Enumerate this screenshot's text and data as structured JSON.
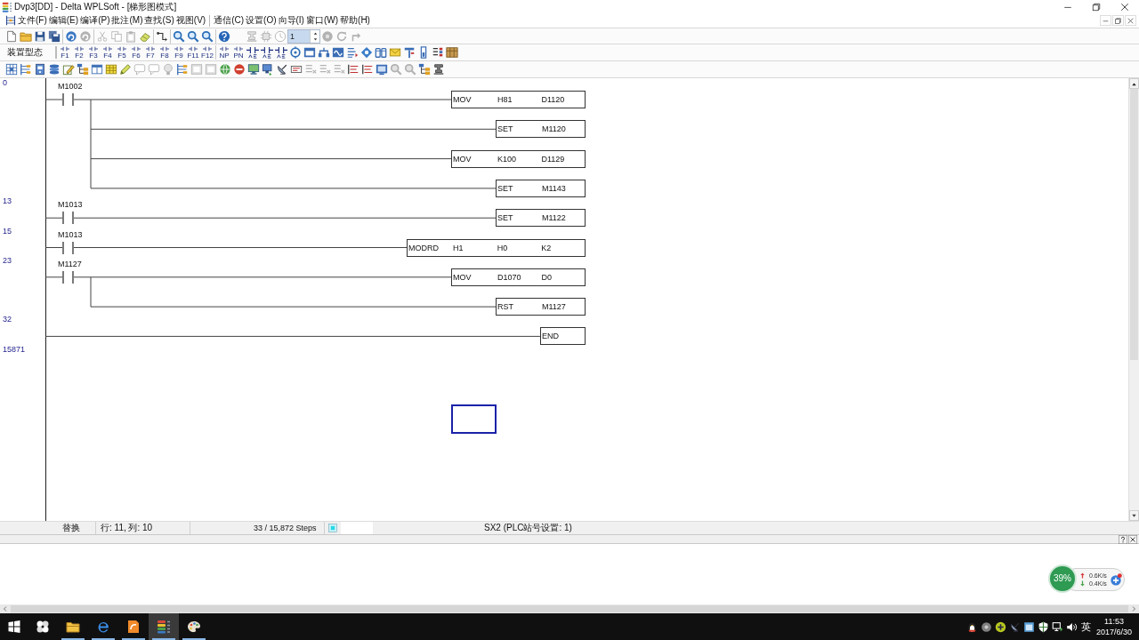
{
  "window": {
    "title": "Dvp3[DD] - Delta WPLSoft - [梯形图模式]"
  },
  "menu_bar": {
    "groups": [
      [
        "文件(F)",
        "编辑(E)",
        "编译(P)",
        "批注(M)",
        "查找(S)",
        "视图(V)"
      ],
      [
        "通信(C)",
        "设置(O)",
        "向导(I)",
        "窗口(W)",
        "帮助(H)"
      ]
    ]
  },
  "toolbar_main": {
    "groups": [
      [
        {
          "kind": "page",
          "disabled": false
        },
        {
          "kind": "folder",
          "disabled": false
        },
        {
          "kind": "floppy-disk",
          "disabled": false
        },
        {
          "kind": "floppy-stack",
          "disabled": false
        }
      ],
      [
        {
          "kind": "round-arrow",
          "disabled": false
        },
        {
          "kind": "round-arrow",
          "disabled": true
        }
      ],
      [
        {
          "kind": "scissors",
          "disabled": true
        },
        {
          "kind": "copy-pages",
          "disabled": true
        },
        {
          "kind": "clipboard",
          "disabled": true
        },
        {
          "kind": "eraser",
          "disabled": false
        }
      ],
      [
        {
          "kind": "wire-hook",
          "disabled": false
        }
      ],
      [
        {
          "kind": "magnifier",
          "disabled": false
        },
        {
          "kind": "magnifier",
          "disabled": false
        },
        {
          "kind": "magnifier",
          "disabled": false
        }
      ],
      [
        {
          "kind": "help",
          "disabled": false
        }
      ],
      [
        {
          "kind": "stamp",
          "disabled": true
        },
        {
          "kind": "chip",
          "disabled": true
        },
        {
          "kind": "clock",
          "disabled": true
        },
        {
          "kind": "spin-field",
          "value": "1"
        },
        {
          "kind": "disc",
          "disabled": true
        },
        {
          "kind": "refresh",
          "disabled": true
        },
        {
          "kind": "bent-arrow",
          "disabled": true
        }
      ]
    ]
  },
  "toolbar_ladder": {
    "device_label": "装置型态",
    "groups": [
      [
        {
          "kind": "contact-key",
          "label": "F1"
        },
        {
          "kind": "contact-key",
          "label": "F2"
        },
        {
          "kind": "contact-key",
          "label": "F3"
        },
        {
          "kind": "contact-key",
          "label": "F4"
        },
        {
          "kind": "contact-key",
          "label": "F5"
        },
        {
          "kind": "contact-key",
          "label": "F6"
        },
        {
          "kind": "contact-key",
          "label": "F7"
        },
        {
          "kind": "contact-key",
          "label": "F8"
        },
        {
          "kind": "contact-key",
          "label": "F9"
        },
        {
          "kind": "contact-key",
          "label": "F11"
        },
        {
          "kind": "contact-key",
          "label": "F12"
        }
      ],
      [
        {
          "kind": "contact-key",
          "label": "NP"
        },
        {
          "kind": "contact-key",
          "label": "PN"
        },
        {
          "kind": "contact-variant"
        },
        {
          "kind": "contact-variant"
        },
        {
          "kind": "contact-variant"
        },
        {
          "kind": "target"
        },
        {
          "kind": "window-panel"
        },
        {
          "kind": "bridge"
        },
        {
          "kind": "wave"
        },
        {
          "kind": "list-arrows"
        },
        {
          "kind": "diamond"
        },
        {
          "kind": "columns"
        },
        {
          "kind": "envelope"
        },
        {
          "kind": "pin"
        },
        {
          "kind": "gauge"
        },
        {
          "kind": "list-bars"
        },
        {
          "kind": "grid-block"
        }
      ]
    ]
  },
  "toolbar_tools": [
    {
      "kind": "grid-chart",
      "disabled": false
    },
    {
      "kind": "ladder-list",
      "disabled": false
    },
    {
      "kind": "device",
      "disabled": false
    },
    {
      "kind": "stack",
      "disabled": false
    },
    {
      "kind": "pencil-square",
      "disabled": false
    },
    {
      "kind": "tree",
      "disabled": false
    },
    {
      "kind": "window",
      "disabled": false
    },
    {
      "kind": "notes",
      "disabled": false
    },
    {
      "kind": "pencil",
      "disabled": false
    },
    {
      "kind": "speech",
      "disabled": true
    },
    {
      "kind": "speech",
      "disabled": true
    },
    {
      "kind": "bulb",
      "disabled": true
    },
    {
      "kind": "ladder-list",
      "disabled": false
    },
    {
      "kind": "panel",
      "disabled": true
    },
    {
      "kind": "panel",
      "disabled": true
    },
    {
      "kind": "globe",
      "disabled": false
    },
    {
      "kind": "stop",
      "disabled": false
    },
    {
      "kind": "monitor",
      "disabled": false
    },
    {
      "kind": "monitor-arrow",
      "disabled": false
    },
    {
      "kind": "satellite",
      "disabled": false
    },
    {
      "kind": "cmd-block",
      "disabled": false
    },
    {
      "kind": "list-cross",
      "disabled": true
    },
    {
      "kind": "list-cross",
      "disabled": true
    },
    {
      "kind": "list-cross",
      "disabled": true
    },
    {
      "kind": "list-lines",
      "disabled": false
    },
    {
      "kind": "list-lines",
      "disabled": false
    },
    {
      "kind": "screen",
      "disabled": false
    },
    {
      "kind": "magnifier",
      "disabled": true
    },
    {
      "kind": "magnifier",
      "disabled": true
    },
    {
      "kind": "tree",
      "disabled": false
    },
    {
      "kind": "stamp",
      "disabled": false
    }
  ],
  "ladder": {
    "rungs": [
      {
        "step": "0",
        "contact": {
          "label": "M1002",
          "kind": "normally_open"
        },
        "outputs": [
          {
            "op": "MOV",
            "operands": [
              "H81",
              "D1120"
            ]
          },
          {
            "op": "SET",
            "operands": [
              "M1120"
            ]
          },
          {
            "op": "MOV",
            "operands": [
              "K100",
              "D1129"
            ]
          },
          {
            "op": "SET",
            "operands": [
              "M1143"
            ]
          }
        ]
      },
      {
        "step": "13",
        "contact": {
          "label": "M1013",
          "kind": "normally_open"
        },
        "outputs": [
          {
            "op": "SET",
            "operands": [
              "M1122"
            ]
          }
        ]
      },
      {
        "step": "15",
        "contact": {
          "label": "M1013",
          "kind": "normally_open"
        },
        "outputs": [
          {
            "op": "MODRD",
            "operands": [
              "H1",
              "H0",
              "K2"
            ]
          }
        ]
      },
      {
        "step": "23",
        "contact": {
          "label": "M1127",
          "kind": "normally_open"
        },
        "outputs": [
          {
            "op": "MOV",
            "operands": [
              "D1070",
              "D0"
            ]
          },
          {
            "op": "RST",
            "operands": [
              "M1127"
            ]
          }
        ]
      },
      {
        "step": "32",
        "outputs": [
          {
            "op": "END"
          }
        ]
      },
      {
        "step": "15871"
      }
    ]
  },
  "status_bar": {
    "mode": "替换",
    "position": "行: 11, 列: 10",
    "steps": "33 / 15,872 Steps",
    "plc": "SX2 (PLC站号设置: 1)"
  },
  "speed_widget": {
    "usage": "39%",
    "upload": "0.6K/s",
    "download": "0.4K/s"
  },
  "taskbar": {
    "apps": [
      {
        "kind": "windows-logo",
        "running": false,
        "selected": false
      },
      {
        "kind": "pinwheel",
        "running": false,
        "selected": false
      },
      {
        "kind": "folder",
        "running": true,
        "selected": false
      },
      {
        "kind": "browser",
        "running": true,
        "selected": false
      },
      {
        "kind": "document",
        "running": true,
        "selected": false
      },
      {
        "kind": "stacked-bars",
        "running": true,
        "selected": true
      },
      {
        "kind": "palette",
        "running": true,
        "selected": false
      }
    ],
    "tray": [
      {
        "kind": "penguin"
      },
      {
        "kind": "disc"
      },
      {
        "kind": "plus-circle"
      },
      {
        "kind": "satellite"
      },
      {
        "kind": "window-tile"
      },
      {
        "kind": "shield"
      },
      {
        "kind": "network"
      },
      {
        "kind": "speaker"
      }
    ],
    "input_method": "英",
    "time": "11:53",
    "date": "2017/6/30"
  }
}
